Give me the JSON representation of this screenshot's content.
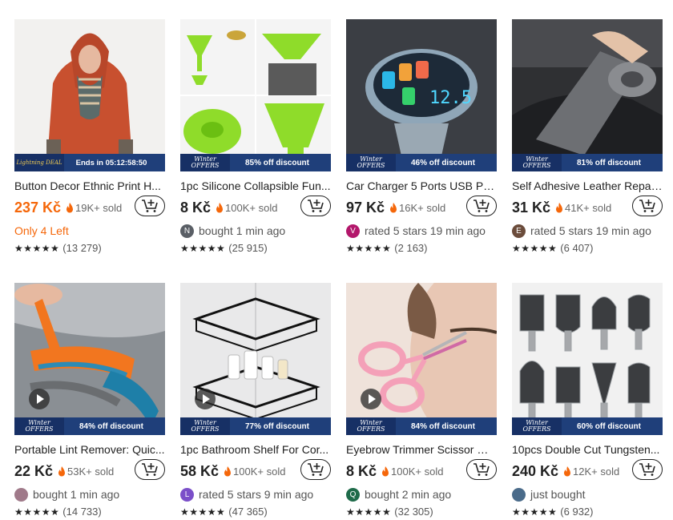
{
  "products": [
    {
      "title": "Button Decor Ethnic Print H...",
      "price": "237 Kč",
      "price_orange": true,
      "sold": "19K+ sold",
      "badge": "Lightning DEAL",
      "badge_type": "ld",
      "discount": "Ends in 05:12:58:50",
      "info_type": "stock",
      "info": "Only 4 Left",
      "avatar_letter": "",
      "avatar_color": "",
      "stars": "★★★★★",
      "reviews": "(13 279)",
      "image": "hoodie-image"
    },
    {
      "title": "1pc Silicone Collapsible Fun...",
      "price": "8 Kč",
      "price_orange": false,
      "sold": "100K+ sold",
      "badge": "Winter OFFERS",
      "badge_type": "wo",
      "discount": "85% off discount",
      "info_type": "user",
      "info": "bought 1 min ago",
      "avatar_letter": "N",
      "avatar_color": "#5a5f66",
      "stars": "★★★★★",
      "reviews": "(25 915)",
      "image": "funnel-image"
    },
    {
      "title": "Car Charger 5 Ports USB PD...",
      "price": "97 Kč",
      "price_orange": false,
      "sold": "16K+ sold",
      "badge": "Winter OFFERS",
      "badge_type": "wo",
      "discount": "46% off discount",
      "info_type": "user",
      "info": "rated 5 stars 19 min ago",
      "avatar_letter": "V",
      "avatar_color": "#b3176b",
      "stars": "★★★★★",
      "reviews": "(2 163)",
      "image": "charger-image"
    },
    {
      "title": "Self Adhesive Leather Repai...",
      "price": "31 Kč",
      "price_orange": false,
      "sold": "41K+ sold",
      "badge": "Winter OFFERS",
      "badge_type": "wo",
      "discount": "81% off discount",
      "info_type": "user",
      "info": "rated 5 stars 19 min ago",
      "avatar_letter": "E",
      "avatar_color": "#6b4c3b",
      "stars": "★★★★★",
      "reviews": "(6 407)",
      "image": "tape-image"
    },
    {
      "title": "Portable Lint Remover: Quic...",
      "price": "22 Kč",
      "price_orange": false,
      "sold": "53K+ sold",
      "badge": "Winter OFFERS",
      "badge_type": "wo",
      "discount": "84% off discount",
      "info_type": "user",
      "info": "bought 1 min ago",
      "avatar_letter": "",
      "avatar_color": "#a07a8a",
      "stars": "★★★★★",
      "reviews": "(14 733)",
      "image": "lint-image",
      "video": true
    },
    {
      "title": "1pc Bathroom Shelf For Cor...",
      "price": "58 Kč",
      "price_orange": false,
      "sold": "100K+ sold",
      "badge": "Winter OFFERS",
      "badge_type": "wo",
      "discount": "77% off discount",
      "info_type": "user",
      "info": "rated 5 stars 9 min ago",
      "avatar_letter": "L",
      "avatar_color": "#7b4fc9",
      "stars": "★★★★★",
      "reviews": "(47 365)",
      "image": "shelf-image",
      "video": true
    },
    {
      "title": "Eyebrow Trimmer Scissor Wi...",
      "price": "8 Kč",
      "price_orange": false,
      "sold": "100K+ sold",
      "badge": "Winter OFFERS",
      "badge_type": "wo",
      "discount": "84% off discount",
      "info_type": "user",
      "info": "bought 2 min ago",
      "avatar_letter": "Q",
      "avatar_color": "#1f6b4a",
      "stars": "★★★★★",
      "reviews": "(32 305)",
      "image": "scissor-image",
      "video": true
    },
    {
      "title": "10pcs Double Cut Tungsten...",
      "price": "240 Kč",
      "price_orange": false,
      "sold": "12K+ sold",
      "badge": "Winter OFFERS",
      "badge_type": "wo",
      "discount": "60% off discount",
      "info_type": "user",
      "info": "just bought",
      "avatar_letter": "",
      "avatar_color": "#4a6b8a",
      "stars": "★★★★★",
      "reviews": "(6 932)",
      "image": "burr-image"
    }
  ],
  "colors": {
    "accent": "#f5670a",
    "banner": "#1f3f7a"
  }
}
